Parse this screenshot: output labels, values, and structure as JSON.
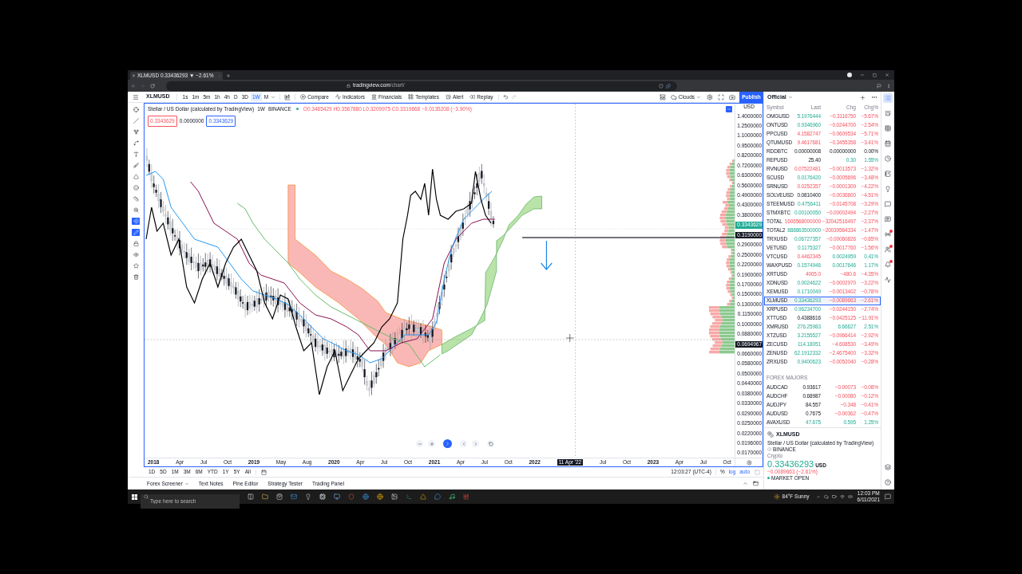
{
  "browser": {
    "tab": {
      "title": "XLMUSD 0.33436293 ▼ −2.61%",
      "selected": true
    },
    "url": {
      "host": "tradingview.com",
      "path": "/chart/"
    }
  },
  "toolbar": {
    "symbol": "XLMUSD",
    "intervals": [
      {
        "label": "1s",
        "selected": false
      },
      {
        "label": "1m",
        "selected": false
      },
      {
        "label": "5m",
        "selected": false
      },
      {
        "label": "1h",
        "selected": false
      },
      {
        "label": "4h",
        "selected": false
      },
      {
        "label": "D",
        "selected": false
      },
      {
        "label": "3D",
        "selected": false
      },
      {
        "label": "1W",
        "selected": true
      },
      {
        "label": "M",
        "selected": false
      }
    ],
    "actions": [
      {
        "kind": "compare",
        "label": "Compare"
      },
      {
        "kind": "indicators",
        "label": "Indicators"
      },
      {
        "kind": "financials",
        "label": "Financials"
      },
      {
        "kind": "templates",
        "label": "Templates"
      },
      {
        "kind": "alert",
        "label": "Alert"
      },
      {
        "kind": "replay",
        "label": "Replay"
      }
    ],
    "layout_name": "Clouds",
    "publish_label": "Publish"
  },
  "drawing_tools": [
    {
      "kind": "crosshair",
      "selected": false
    },
    {
      "kind": "trend-line",
      "selected": false
    },
    {
      "kind": "fork",
      "selected": false
    },
    {
      "kind": "curve",
      "selected": false
    },
    {
      "kind": "text",
      "selected": false
    },
    {
      "kind": "brush",
      "selected": false
    },
    {
      "kind": "shapes",
      "selected": false
    },
    {
      "kind": "emoji",
      "selected": false
    },
    {
      "kind": "ruler",
      "selected": false
    },
    {
      "kind": "zoom",
      "selected": false
    },
    {
      "kind": "magnet",
      "selected": true
    },
    {
      "kind": "pencil",
      "selected": true
    },
    {
      "kind": "lock",
      "selected": false
    },
    {
      "kind": "visibility",
      "selected": false
    },
    {
      "kind": "favorites",
      "selected": false
    },
    {
      "kind": "trash",
      "selected": false
    }
  ],
  "chart": {
    "legend": {
      "symbol_name": "Stellar / US Dollar (calculated by TradingView)",
      "interval": "1W",
      "exchange": "BINANCE",
      "ohlc": "O0.3465429 H0.3567880 L0.3209975 C0.3319668 −0.0135208 (−3.90%)",
      "bid": "0.3343629",
      "spread": "0.0000000",
      "ask": "0.3343629"
    },
    "price_scale": {
      "currency": "USD",
      "labels": [
        {
          "kind": "tick",
          "text": "1.4000000"
        },
        {
          "kind": "tick",
          "text": "1.2500000"
        },
        {
          "kind": "tick",
          "text": "1.1000000"
        },
        {
          "kind": "tick",
          "text": "0.9500000"
        },
        {
          "kind": "tick",
          "text": "0.8200000"
        },
        {
          "kind": "tick",
          "text": "0.7200000"
        },
        {
          "kind": "tick",
          "text": "0.6300000"
        },
        {
          "kind": "tick",
          "text": "0.5600000"
        },
        {
          "kind": "tick",
          "text": "0.4900000"
        },
        {
          "kind": "tick",
          "text": "0.4300000"
        },
        {
          "kind": "tick",
          "text": "0.3800000"
        },
        {
          "kind": "last",
          "text": "0.3343629"
        },
        {
          "kind": "line",
          "text": "0.3190000"
        },
        {
          "kind": "tick",
          "text": "0.2900000"
        },
        {
          "kind": "tick",
          "text": "0.2500000"
        },
        {
          "kind": "tick",
          "text": "0.2200000"
        },
        {
          "kind": "tick",
          "text": "0.1900000"
        },
        {
          "kind": "tick",
          "text": "0.1700000"
        },
        {
          "kind": "tick",
          "text": "0.1500000"
        },
        {
          "kind": "tick",
          "text": "0.1300000"
        },
        {
          "kind": "tick",
          "text": "0.1150000"
        },
        {
          "kind": "tick",
          "text": "0.1000000"
        },
        {
          "kind": "tick",
          "text": "0.0880000"
        },
        {
          "kind": "crosshair",
          "text": "0.0694967"
        },
        {
          "kind": "tick",
          "text": "0.0660000"
        },
        {
          "kind": "tick",
          "text": "0.0580000"
        },
        {
          "kind": "tick",
          "text": "0.0500000"
        },
        {
          "kind": "tick",
          "text": "0.0440000"
        },
        {
          "kind": "tick",
          "text": "0.0380000"
        },
        {
          "kind": "tick",
          "text": "0.0330000"
        },
        {
          "kind": "tick",
          "text": "0.0290000"
        },
        {
          "kind": "tick",
          "text": "0.0250000"
        },
        {
          "kind": "tick",
          "text": "0.0220000"
        },
        {
          "kind": "tick",
          "text": "0.0196000"
        },
        {
          "kind": "tick",
          "text": "0.0170000"
        }
      ]
    },
    "time_scale": {
      "labels": [
        {
          "kind": "year",
          "text": "2018"
        },
        {
          "kind": "month",
          "text": "Apr"
        },
        {
          "kind": "month",
          "text": "Jul"
        },
        {
          "kind": "month",
          "text": "Oct"
        },
        {
          "kind": "year",
          "text": "2019"
        },
        {
          "kind": "month",
          "text": "May"
        },
        {
          "kind": "month",
          "text": "Aug"
        },
        {
          "kind": "year",
          "text": "2020"
        },
        {
          "kind": "month",
          "text": "Apr"
        },
        {
          "kind": "month",
          "text": "Jul"
        },
        {
          "kind": "month",
          "text": "Oct"
        },
        {
          "kind": "year",
          "text": "2021"
        },
        {
          "kind": "month",
          "text": "Apr"
        },
        {
          "kind": "month",
          "text": "Jul"
        },
        {
          "kind": "month",
          "text": "Oct"
        },
        {
          "kind": "year",
          "text": "2022"
        },
        {
          "kind": "crosshair",
          "text": "11 Apr '22"
        },
        {
          "kind": "month",
          "text": "Jul"
        },
        {
          "kind": "month",
          "text": "Oct"
        },
        {
          "kind": "year",
          "text": "2023"
        },
        {
          "kind": "month",
          "text": "Apr"
        },
        {
          "kind": "month",
          "text": "Jul"
        },
        {
          "kind": "month",
          "text": "Oct"
        }
      ]
    }
  },
  "range_bar": {
    "ranges": [
      "1D",
      "5D",
      "1M",
      "3M",
      "6M",
      "YTD",
      "1Y",
      "5Y",
      "All"
    ],
    "clock": "12:03:27 (UTC-4)",
    "scale_options": [
      {
        "label": "%",
        "on": false
      },
      {
        "label": "log",
        "on": true
      },
      {
        "label": "auto",
        "on": true
      }
    ]
  },
  "bottom_panel": {
    "tabs": [
      "Forex Screener",
      "Text Notes",
      "Pine Editor",
      "Strategy Tester",
      "Trading Panel"
    ]
  },
  "watchlist": {
    "name": "Official",
    "columns": [
      "Symbol",
      "Last",
      "Chg",
      "Chg%"
    ],
    "rows": [
      {
        "symbol": "OMGUSD",
        "last": {
          "text": "5.1976444",
          "kind": "up"
        },
        "chg": {
          "text": "−0.3116750",
          "kind": "down"
        },
        "chg_pct": {
          "text": "−5.67%",
          "kind": "down"
        },
        "selected": false
      },
      {
        "symbol": "ONTUSD",
        "last": {
          "text": "0.9346960",
          "kind": "up"
        },
        "chg": {
          "text": "−0.0244700",
          "kind": "down"
        },
        "chg_pct": {
          "text": "−2.54%",
          "kind": "down"
        },
        "selected": false
      },
      {
        "symbol": "PPCUSD",
        "last": {
          "text": "4.1582747",
          "kind": "down"
        },
        "chg": {
          "text": "−0.0609534",
          "kind": "down"
        },
        "chg_pct": {
          "text": "−5.71%",
          "kind": "down"
        },
        "selected": false
      },
      {
        "symbol": "QTUMUSD",
        "last": {
          "text": "9.4617681",
          "kind": "down"
        },
        "chg": {
          "text": "−0.3455358",
          "kind": "down"
        },
        "chg_pct": {
          "text": "−3.41%",
          "kind": "down"
        },
        "selected": false
      },
      {
        "symbol": "RDDBTC",
        "last": {
          "text": "0.00000008",
          "kind": "flat"
        },
        "chg": {
          "text": "0.00000000",
          "kind": "flat"
        },
        "chg_pct": {
          "text": "0.00%",
          "kind": "flat"
        },
        "selected": false
      },
      {
        "symbol": "REPUSD",
        "last": {
          "text": "25.40",
          "kind": "flat"
        },
        "chg": {
          "text": "0.30",
          "kind": "up"
        },
        "chg_pct": {
          "text": "1.55%",
          "kind": "up"
        },
        "selected": false
      },
      {
        "symbol": "RVNUSD",
        "last": {
          "text": "0.07522481",
          "kind": "down"
        },
        "chg": {
          "text": "−0.0013573",
          "kind": "down"
        },
        "chg_pct": {
          "text": "−1.32%",
          "kind": "down"
        },
        "selected": false
      },
      {
        "symbol": "SCUSD",
        "last": {
          "text": "0.0176420",
          "kind": "up"
        },
        "chg": {
          "text": "−0.0005696",
          "kind": "down"
        },
        "chg_pct": {
          "text": "−3.48%",
          "kind": "down"
        },
        "selected": false
      },
      {
        "symbol": "SRNUSD",
        "last": {
          "text": "0.0252357",
          "kind": "down"
        },
        "chg": {
          "text": "−0.0001309",
          "kind": "down"
        },
        "chg_pct": {
          "text": "−4.22%",
          "kind": "down"
        },
        "selected": false
      },
      {
        "symbol": "SOLVEUSD",
        "last": {
          "text": "0.0810400",
          "kind": "flat"
        },
        "chg": {
          "text": "−0.0036600",
          "kind": "down"
        },
        "chg_pct": {
          "text": "−4.51%",
          "kind": "down"
        },
        "selected": false
      },
      {
        "symbol": "STEEMUSD",
        "last": {
          "text": "0.4756411",
          "kind": "up"
        },
        "chg": {
          "text": "−0.0145708",
          "kind": "down"
        },
        "chg_pct": {
          "text": "−3.29%",
          "kind": "down"
        },
        "selected": false
      },
      {
        "symbol": "STMXBTC",
        "last": {
          "text": "0.00100050",
          "kind": "up"
        },
        "chg": {
          "text": "−0.00002494",
          "kind": "down"
        },
        "chg_pct": {
          "text": "−2.27%",
          "kind": "down"
        },
        "selected": false
      },
      {
        "symbol": "TOTAL",
        "last": {
          "text": "1606568000000",
          "kind": "down"
        },
        "chg": {
          "text": "−32042516497",
          "kind": "down"
        },
        "chg_pct": {
          "text": "−2.37%",
          "kind": "down"
        },
        "selected": false
      },
      {
        "symbol": "TOTAL2",
        "last": {
          "text": "888863500000",
          "kind": "up"
        },
        "chg": {
          "text": "−20039564334",
          "kind": "down"
        },
        "chg_pct": {
          "text": "−1.47%",
          "kind": "down"
        },
        "selected": false
      },
      {
        "symbol": "TRXUSD",
        "last": {
          "text": "0.06727357",
          "kind": "up"
        },
        "chg": {
          "text": "−0.00060826",
          "kind": "down"
        },
        "chg_pct": {
          "text": "−0.85%",
          "kind": "down"
        },
        "selected": false
      },
      {
        "symbol": "VETUSD",
        "last": {
          "text": "0.1175327",
          "kind": "up"
        },
        "chg": {
          "text": "−0.0017760",
          "kind": "down"
        },
        "chg_pct": {
          "text": "−1.56%",
          "kind": "down"
        },
        "selected": false
      },
      {
        "symbol": "VTCUSD",
        "last": {
          "text": "0.4462345",
          "kind": "down"
        },
        "chg": {
          "text": "0.0024959",
          "kind": "up"
        },
        "chg_pct": {
          "text": "0.41%",
          "kind": "up"
        },
        "selected": false
      },
      {
        "symbol": "WAXPUSD",
        "last": {
          "text": "0.1574946",
          "kind": "up"
        },
        "chg": {
          "text": "0.0017646",
          "kind": "up"
        },
        "chg_pct": {
          "text": "1.17%",
          "kind": "up"
        },
        "selected": false
      },
      {
        "symbol": "XRTUSD",
        "last": {
          "text": "4005.0",
          "kind": "down"
        },
        "chg": {
          "text": "−480.6",
          "kind": "down"
        },
        "chg_pct": {
          "text": "−4.35%",
          "kind": "down"
        },
        "selected": false
      },
      {
        "symbol": "XDNUSD",
        "last": {
          "text": "0.0024622",
          "kind": "up"
        },
        "chg": {
          "text": "−0.0002970",
          "kind": "down"
        },
        "chg_pct": {
          "text": "−3.22%",
          "kind": "down"
        },
        "selected": false
      },
      {
        "symbol": "XEMUSD",
        "last": {
          "text": "0.1710049",
          "kind": "up"
        },
        "chg": {
          "text": "−0.0013402",
          "kind": "down"
        },
        "chg_pct": {
          "text": "−0.78%",
          "kind": "down"
        },
        "selected": false
      },
      {
        "symbol": "XLMUSD",
        "last": {
          "text": "0.33436293",
          "kind": "up"
        },
        "chg": {
          "text": "−0.0089663",
          "kind": "down"
        },
        "chg_pct": {
          "text": "−2.61%",
          "kind": "down"
        },
        "selected": true
      },
      {
        "symbol": "XRPUSD",
        "last": {
          "text": "0.96234700",
          "kind": "up"
        },
        "chg": {
          "text": "−0.0244150",
          "kind": "down"
        },
        "chg_pct": {
          "text": "−2.74%",
          "kind": "down"
        },
        "selected": false
      },
      {
        "symbol": "XTTUSD",
        "last": {
          "text": "0.4388616",
          "kind": "flat"
        },
        "chg": {
          "text": "−0.0425125",
          "kind": "down"
        },
        "chg_pct": {
          "text": "−11.91%",
          "kind": "down"
        },
        "selected": false
      },
      {
        "symbol": "XMRUSD",
        "last": {
          "text": "276.25983",
          "kind": "up"
        },
        "chg": {
          "text": "6.66627",
          "kind": "up"
        },
        "chg_pct": {
          "text": "2.51%",
          "kind": "up"
        },
        "selected": false
      },
      {
        "symbol": "XTZUSD",
        "last": {
          "text": "3.2155527",
          "kind": "up"
        },
        "chg": {
          "text": "−0.0966414",
          "kind": "down"
        },
        "chg_pct": {
          "text": "−2.92%",
          "kind": "down"
        },
        "selected": false
      },
      {
        "symbol": "ZECUSD",
        "last": {
          "text": "114.18051",
          "kind": "up"
        },
        "chg": {
          "text": "−4.608530",
          "kind": "down"
        },
        "chg_pct": {
          "text": "−3.49%",
          "kind": "down"
        },
        "selected": false
      },
      {
        "symbol": "ZENUSD",
        "last": {
          "text": "62.1912332",
          "kind": "up"
        },
        "chg": {
          "text": "−2.4675400",
          "kind": "down"
        },
        "chg_pct": {
          "text": "−3.32%",
          "kind": "down"
        },
        "selected": false
      },
      {
        "symbol": "ZRXUSD",
        "last": {
          "text": "0.9400623",
          "kind": "up"
        },
        "chg": {
          "text": "−0.0052040",
          "kind": "down"
        },
        "chg_pct": {
          "text": "−0.28%",
          "kind": "down"
        },
        "selected": false
      }
    ],
    "section": {
      "title": "FOREX MAJORS",
      "rows": [
        {
          "symbol": "AUDCAD",
          "last": {
            "text": "0.93617",
            "kind": "flat"
          },
          "chg": {
            "text": "−0.00073",
            "kind": "down"
          },
          "chg_pct": {
            "text": "−0.08%",
            "kind": "down"
          },
          "selected": false
        },
        {
          "symbol": "AUDCHF",
          "last": {
            "text": "0.68987",
            "kind": "flat"
          },
          "chg": {
            "text": "−0.00080",
            "kind": "down"
          },
          "chg_pct": {
            "text": "−0.12%",
            "kind": "down"
          },
          "selected": false
        },
        {
          "symbol": "AUDJPY",
          "last": {
            "text": "84.557",
            "kind": "flat"
          },
          "chg": {
            "text": "−0.348",
            "kind": "down"
          },
          "chg_pct": {
            "text": "−0.41%",
            "kind": "down"
          },
          "selected": false
        },
        {
          "symbol": "AUDUSD",
          "last": {
            "text": "0.7675",
            "kind": "flat"
          },
          "chg": {
            "text": "−0.00362",
            "kind": "down"
          },
          "chg_pct": {
            "text": "−0.47%",
            "kind": "down"
          },
          "selected": false
        },
        {
          "symbol": "AVAXUSD",
          "last": {
            "text": "47.675",
            "kind": "up"
          },
          "chg": {
            "text": "0.595",
            "kind": "up"
          },
          "chg_pct": {
            "text": "1.25%",
            "kind": "up"
          },
          "selected": false
        }
      ]
    }
  },
  "symbol_details": {
    "symbol": "XLMUSD",
    "description": "Stellar / US Dollar (calculated by TradingView)",
    "exchange": "BINANCE",
    "type": "Crypto",
    "price": "0.33436293",
    "currency": "USD",
    "change": "−0.0089663 (−2.61%)",
    "status": "MARKET OPEN"
  },
  "sidebar_icons": [
    {
      "kind": "watchlist",
      "selected": true,
      "badge": false
    },
    {
      "kind": "alerts",
      "selected": false,
      "badge": false
    },
    {
      "kind": "data-window",
      "selected": false,
      "badge": false
    },
    {
      "kind": "calendar",
      "selected": false,
      "badge": false
    },
    {
      "kind": "clock",
      "selected": false,
      "badge": false
    },
    {
      "kind": "notes",
      "selected": false,
      "badge": false
    },
    {
      "kind": "ideas",
      "selected": false,
      "badge": false
    },
    {
      "kind": "chats",
      "selected": false,
      "badge": false
    },
    {
      "kind": "messages",
      "selected": false,
      "badge": false
    },
    {
      "kind": "streams",
      "selected": false,
      "badge": true
    },
    {
      "kind": "people",
      "selected": false,
      "badge": true
    },
    {
      "kind": "notifications",
      "selected": false,
      "badge": true
    },
    {
      "kind": "pulse",
      "selected": false,
      "badge": false
    }
  ],
  "sidebar_footer_icons": [
    {
      "kind": "layers",
      "selected": false,
      "badge": false
    },
    {
      "kind": "help",
      "selected": false,
      "badge": false
    }
  ],
  "taskbar": {
    "search_placeholder": "Type here to search",
    "weather": "84°F Sunny",
    "time": "12:03 PM",
    "date": "6/11/2021"
  }
}
